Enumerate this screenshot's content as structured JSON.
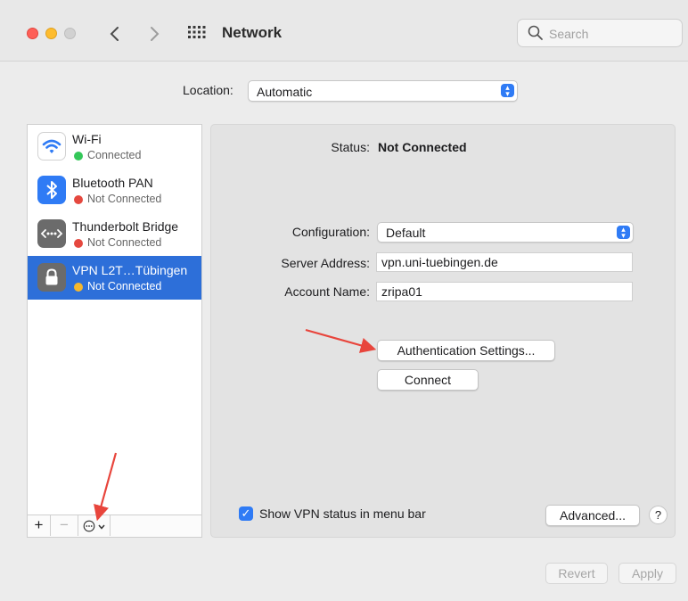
{
  "window": {
    "title": "Network"
  },
  "toolbar": {
    "back_icon": "chevron-left-icon",
    "forward_icon": "chevron-right-icon",
    "grid_icon": "grid-icon",
    "search_placeholder": "Search"
  },
  "location": {
    "label": "Location:",
    "value": "Automatic"
  },
  "services": [
    {
      "name": "Wi-Fi",
      "status": "Connected",
      "status_color": "#34c759",
      "icon": "wifi-icon",
      "selected": false
    },
    {
      "name": "Bluetooth PAN",
      "status": "Not Connected",
      "status_color": "#e5483f",
      "icon": "bluetooth-icon",
      "selected": false
    },
    {
      "name": "Thunderbolt Bridge",
      "status": "Not Connected",
      "status_color": "#e5483f",
      "icon": "thunderbolt-bridge-icon",
      "selected": false
    },
    {
      "name": "VPN L2T…Tübingen",
      "status": "Not Connected",
      "status_color": "#f5b82e",
      "icon": "lock-icon",
      "selected": true
    }
  ],
  "sidebar_buttons": {
    "add": "+",
    "remove": "−"
  },
  "detail": {
    "status_label": "Status:",
    "status_value": "Not Connected",
    "configuration_label": "Configuration:",
    "configuration_value": "Default",
    "server_label": "Server Address:",
    "server_value": "vpn.uni-tuebingen.de",
    "account_label": "Account Name:",
    "account_value": "zripa01",
    "auth_button": "Authentication Settings...",
    "connect_button": "Connect",
    "show_vpn_label": "Show VPN status in menu bar",
    "show_vpn_checked": true,
    "advanced_button": "Advanced...",
    "help_button": "?"
  },
  "footer": {
    "revert": "Revert",
    "apply": "Apply"
  },
  "colors": {
    "accent": "#2f7bf5",
    "selection": "#2d6fd9",
    "annotation_arrow": "#e8453c"
  }
}
